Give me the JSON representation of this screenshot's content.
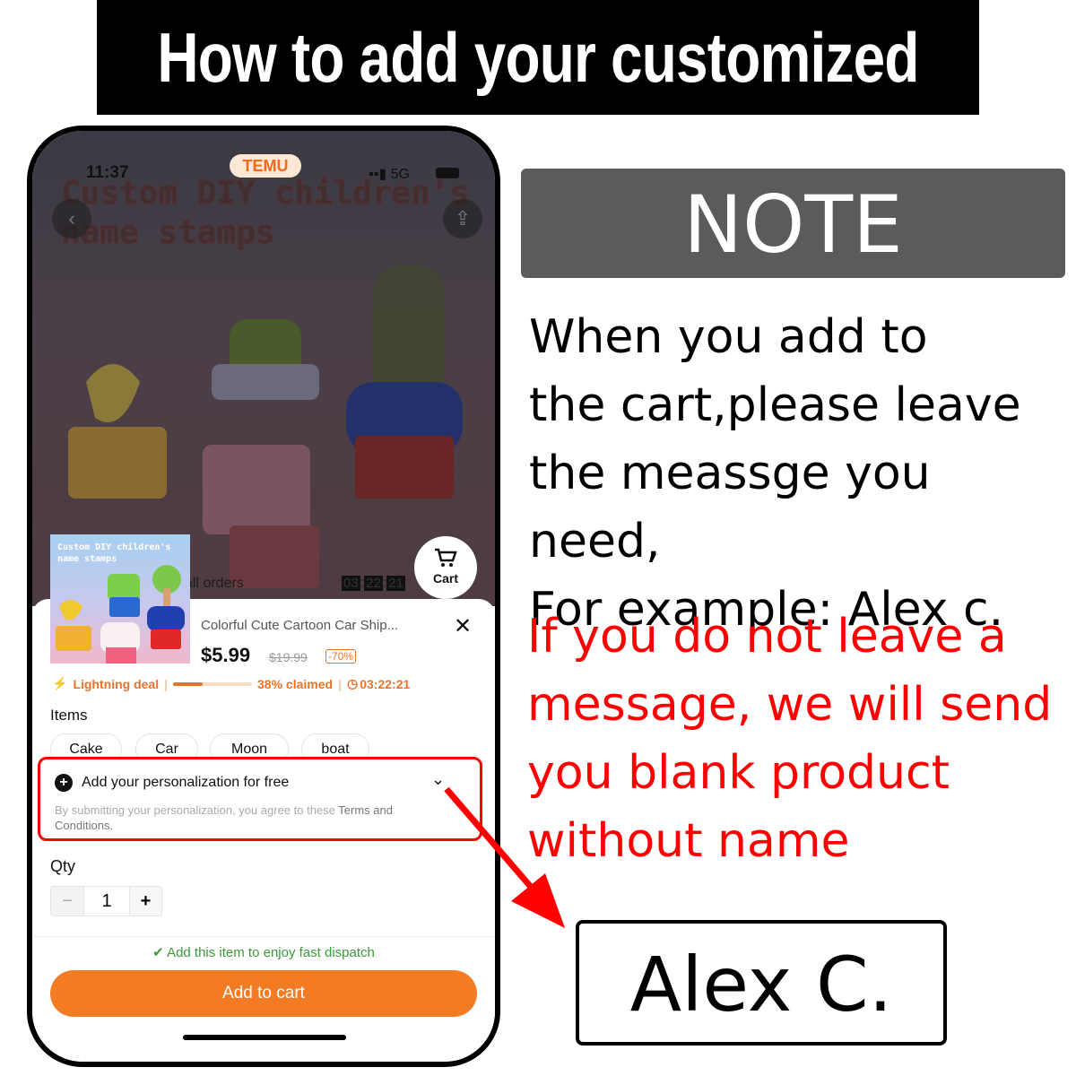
{
  "banner": {
    "title": "How to add your customized text?"
  },
  "phone": {
    "status_bar": {
      "time": "11:37",
      "app_badge": "TEMU",
      "network": "5G"
    },
    "background_title": "Custom DIY children's\nname stamps",
    "orders_text": "all orders",
    "countdown": {
      "h": "03",
      "m": "22",
      "s": "21"
    },
    "cart_button": {
      "label": "Cart",
      "icon": "cart-icon"
    },
    "product": {
      "thumbnail_text": "Custom DIY children's\nname stamps",
      "name": "Colorful Cute Cartoon Car Ship...",
      "price": "$5.99",
      "original_price": "$19.99",
      "discount": "-70%",
      "deal_label": "Lightning deal",
      "claimed_percent": 38,
      "claimed_text": "38% claimed",
      "deal_timer": "03:22:21"
    },
    "items": {
      "label": "Items",
      "options": [
        "Cake",
        "Car",
        "Moon",
        "boat"
      ]
    },
    "personalization": {
      "title": "Add your personalization for free",
      "note": "By submitting your personalization, you agree to these ",
      "terms_link": "Terms and Conditions",
      "note_end": "."
    },
    "qty": {
      "label": "Qty",
      "value": "1",
      "minus": "−",
      "plus": "+"
    },
    "dispatch_text": "Add this item to enjoy fast dispatch",
    "add_to_cart_label": "Add to cart",
    "colors": {
      "accent": "#f37b24",
      "success": "#3a9a3a",
      "highlight": "#ff0000"
    }
  },
  "note": {
    "heading": "NOTE",
    "text": "When you add to\nthe cart,please leave\nthe meassge you need,\n For example: Alex c.",
    "warning": "If you do not leave a\nmessage, we will send\nyou blank product\nwithout name",
    "example": "Alex C."
  }
}
